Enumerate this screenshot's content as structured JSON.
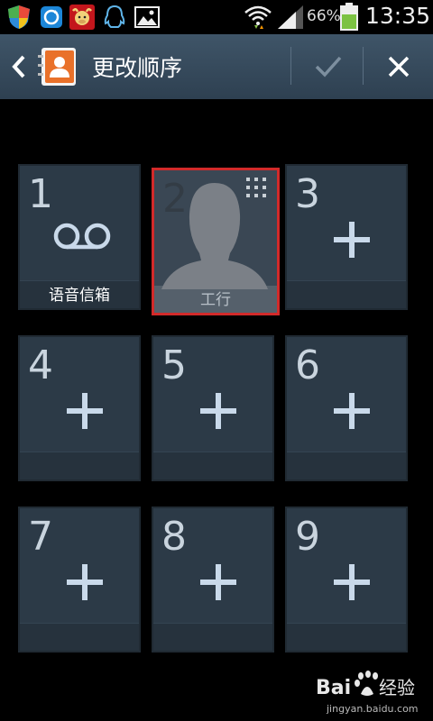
{
  "status_bar": {
    "battery_percent": "66%",
    "time": "13:35",
    "battery_level": 0.66,
    "icons": [
      "shield-icon",
      "sync-icon",
      "cow-app-icon",
      "qq-icon",
      "gallery-icon",
      "wifi-icon",
      "signal-icon",
      "battery-icon"
    ]
  },
  "action_bar": {
    "title": "更改顺序",
    "icons": [
      "back-icon",
      "contacts-app-icon",
      "check-icon",
      "close-icon"
    ]
  },
  "tiles": [
    {
      "number": "1",
      "label": "语音信箱",
      "type": "voicemail"
    },
    {
      "number": "2",
      "label": "工行",
      "type": "contact",
      "selected": true
    },
    {
      "number": "3",
      "label": "",
      "type": "add"
    },
    {
      "number": "4",
      "label": "",
      "type": "add"
    },
    {
      "number": "5",
      "label": "",
      "type": "add"
    },
    {
      "number": "6",
      "label": "",
      "type": "add"
    },
    {
      "number": "7",
      "label": "",
      "type": "add"
    },
    {
      "number": "8",
      "label": "",
      "type": "add"
    },
    {
      "number": "9",
      "label": "",
      "type": "add"
    }
  ],
  "watermark": {
    "url": "jingyan.baidu.com"
  },
  "colors": {
    "action_bar": "#34495b",
    "tile": "#2c3a47",
    "selected_border": "#d22a2a",
    "accent": "#c9d9ea"
  }
}
